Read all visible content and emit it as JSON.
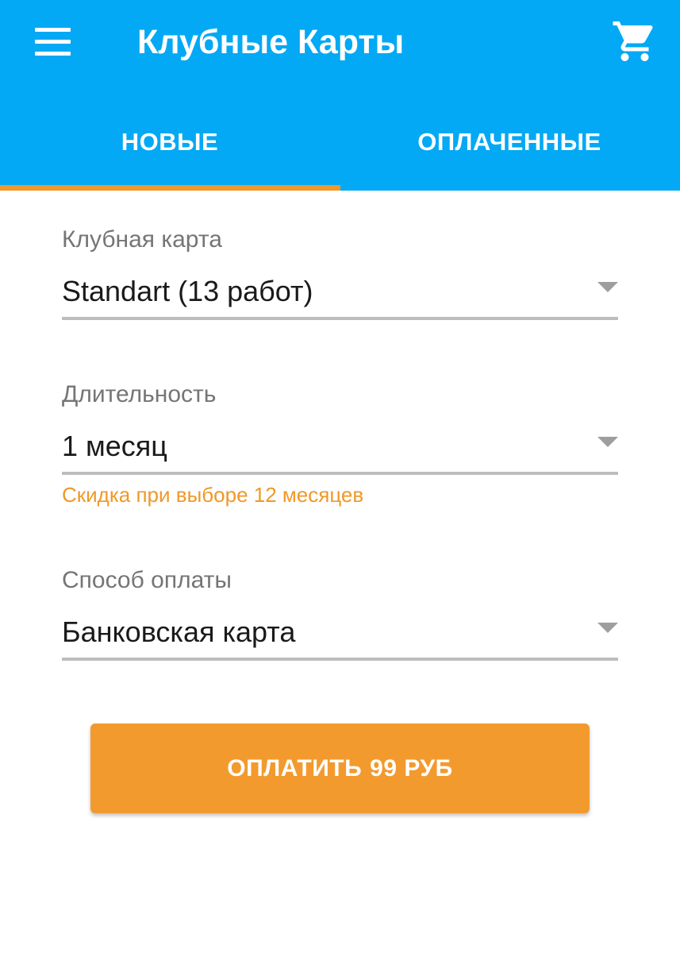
{
  "app": {
    "title": "Клубные Карты",
    "menu_icon": "hamburger-menu-icon",
    "cart_icon": "shopping-cart-icon"
  },
  "tabs": [
    {
      "label": "НОВЫЕ",
      "selected": true
    },
    {
      "label": "ОПЛАЧЕННЫЕ",
      "selected": false
    }
  ],
  "form": {
    "club_card": {
      "label": "Клубная карта",
      "value": "Standart (13 работ)"
    },
    "duration": {
      "label": "Длительность",
      "value": "1 месяц",
      "hint": "Скидка при выборе 12 месяцев"
    },
    "payment_method": {
      "label": "Способ оплаты",
      "value": "Банковская карта"
    }
  },
  "pay_button": {
    "label": "ОПЛАТИТЬ",
    "amount": "99 РУБ"
  },
  "colors": {
    "primary": "#03a9f4",
    "accent": "#f09828",
    "button": "#f39a2e"
  }
}
